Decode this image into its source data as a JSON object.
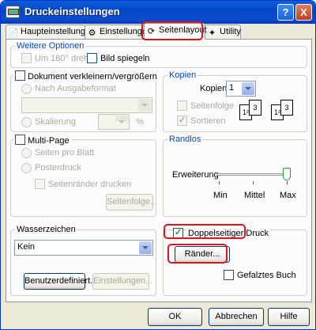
{
  "window": {
    "title": "Druckeinstellungen",
    "help_label": "?",
    "close_label": "X"
  },
  "tabs": [
    {
      "label": "Haupteinstellungen"
    },
    {
      "label": "Einstellungen"
    },
    {
      "label": "Seitenlayout"
    },
    {
      "label": "Utility"
    }
  ],
  "weitere_optionen": {
    "title": "Weitere Optionen",
    "rotate_label": "Um 180° drehen",
    "mirror_label": "Bild spiegeln"
  },
  "resize": {
    "title": "Dokument verkleinern/vergrößern",
    "output_format_label": "Nach Ausgabeformat",
    "scale_label": "Skalierung",
    "percent_label": "%"
  },
  "kopien": {
    "title": "Kopien",
    "copies_label": "Kopien",
    "copies_value": "1",
    "collate_label": "Seitenfolge",
    "sort_label": "Sortieren"
  },
  "multipage": {
    "title": "Multi-Page",
    "pages_per_sheet_label": "Seiten pro Blatt",
    "poster_label": "Posterdruck",
    "print_margins_label": "Seitenränder drucken",
    "page_order_button": "Seitenfolge..."
  },
  "randlos": {
    "title": "Randlos",
    "expansion_label": "Erweiterung",
    "min_label": "Min",
    "mid_label": "Mittel",
    "max_label": "Max",
    "level": "Max"
  },
  "watermark": {
    "title": "Wasserzeichen",
    "selected": "Kein",
    "user_defined_button": "Benutzerdefiniert...",
    "settings_button": "Einstellungen..."
  },
  "duplex": {
    "label": "Doppelseitiger Druck",
    "margins_button": "Ränder...",
    "folded_booklet_label": "Gefalztes Buch"
  },
  "footer": {
    "ok_button": "OK",
    "cancel_button": "Abbrechen",
    "help_button": "Hilfe"
  },
  "colors": {
    "titlebar": "#0a5fd8",
    "highlight": "#e0151b",
    "group_label": "#0046d5"
  }
}
